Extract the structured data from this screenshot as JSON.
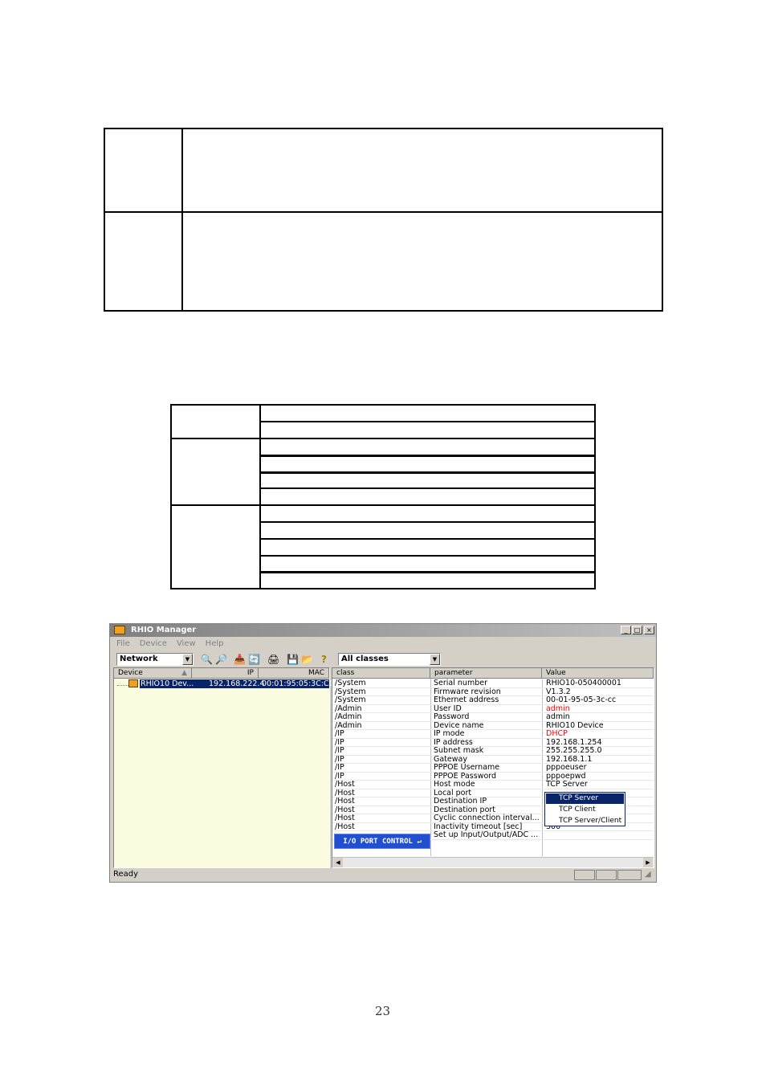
{
  "app": {
    "title": "RHIO Manager",
    "menu": [
      "File",
      "Device",
      "View",
      "Help"
    ],
    "network_select": "Network",
    "class_select": "All classes",
    "device_headers": [
      "Device",
      "IP",
      "MAC"
    ],
    "device": {
      "name": "RHIO10 Dev...",
      "ip": "192.168.222.4",
      "mac": "00:01:95:05:3C:CC"
    },
    "param_headers": [
      "class",
      "parameter",
      "Value"
    ],
    "params": [
      [
        "/System",
        "Serial number",
        "RHIO10-050400001",
        ""
      ],
      [
        "/System",
        "Firmware revision",
        "V1.3.2",
        ""
      ],
      [
        "/System",
        "Ethernet address",
        "00-01-95-05-3c-cc",
        ""
      ],
      [
        "/Admin",
        "User ID",
        "admin",
        "#ff0000"
      ],
      [
        "/Admin",
        "Password",
        "admin",
        ""
      ],
      [
        "/Admin",
        "Device name",
        "RHIO10 Device",
        ""
      ],
      [
        "/IP",
        "IP mode",
        "DHCP",
        "#ff0000"
      ],
      [
        "/IP",
        "IP address",
        "192.168.1.254",
        ""
      ],
      [
        "/IP",
        "Subnet  mask",
        "255.255.255.0",
        ""
      ],
      [
        "/IP",
        "Gateway",
        "192.168.1.1",
        ""
      ],
      [
        "/IP",
        "PPPOE Username",
        "pppoeuser",
        ""
      ],
      [
        "/IP",
        "PPPOE Password",
        "pppoepwd",
        ""
      ],
      [
        "/Host",
        "Host mode",
        "TCP Server",
        ""
      ],
      [
        "/Host",
        "Local port",
        "",
        ""
      ],
      [
        "/Host",
        "Destination IP",
        "",
        ""
      ],
      [
        "/Host",
        "Destination port",
        "",
        ""
      ],
      [
        "/Host",
        "Cyclic connection interval...",
        "",
        ""
      ],
      [
        "/Host",
        "Inactivity timeout [sec]",
        "300",
        ""
      ],
      [
        "",
        "Set up Input/Output/ADC ...",
        "",
        ""
      ]
    ],
    "dropdown": [
      "TCP Server",
      "TCP Client",
      "TCP Server/Client"
    ],
    "io_button": "I/O PORT CONTROL ↵",
    "status": "Ready"
  },
  "page_number": "23"
}
